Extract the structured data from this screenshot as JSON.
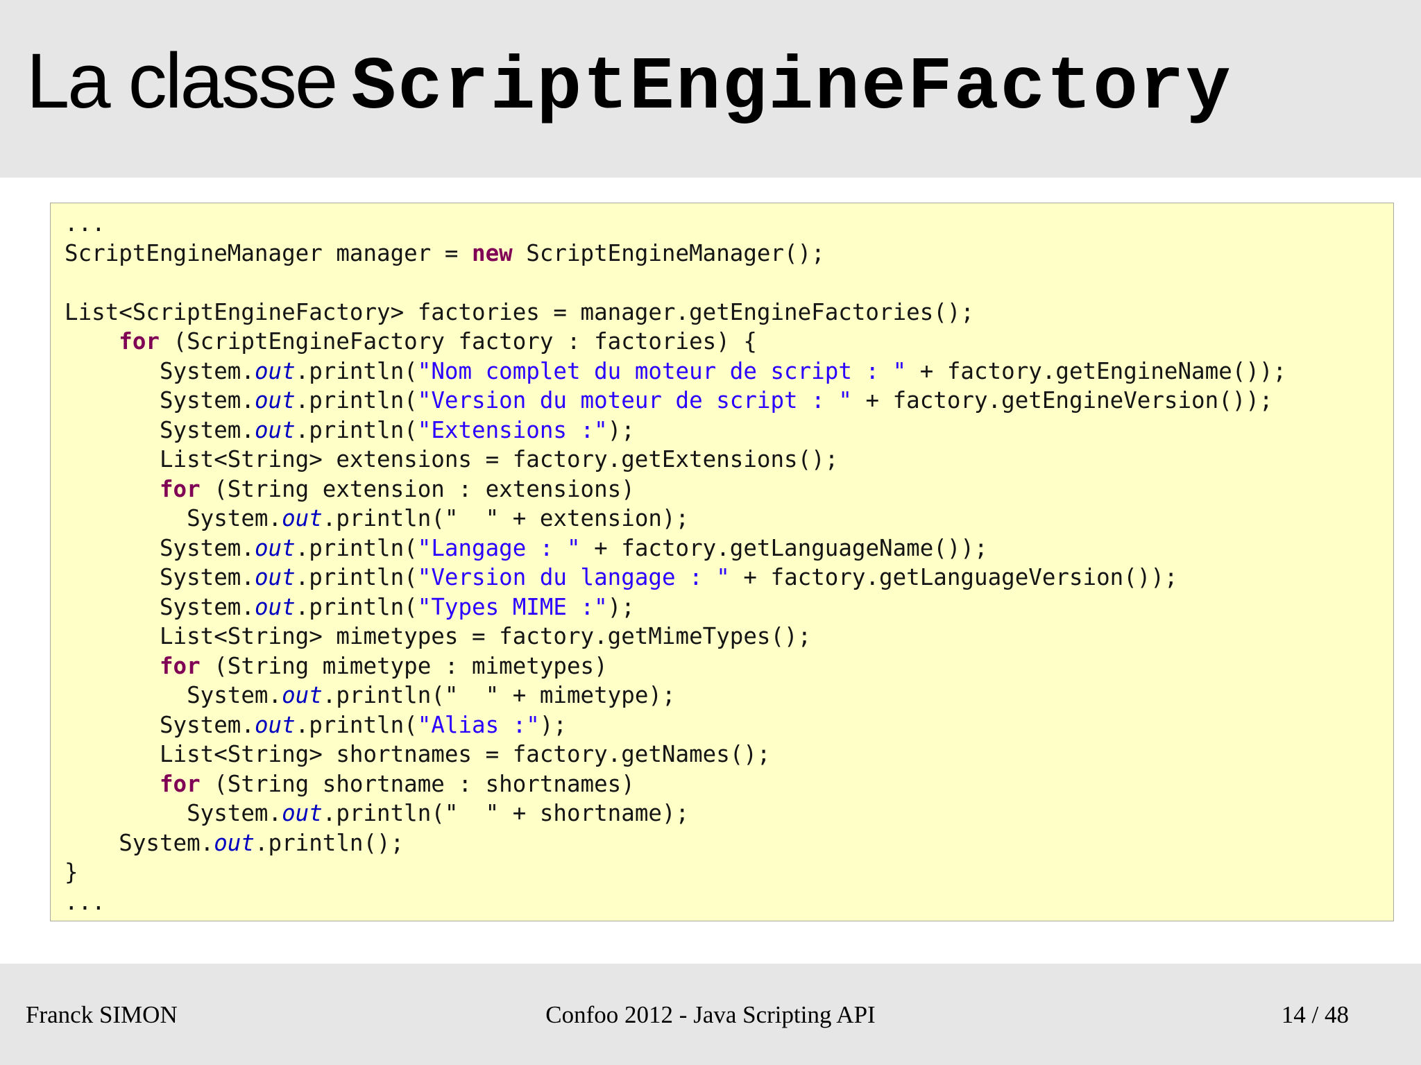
{
  "slide": {
    "title_text": "La classe",
    "title_code": "ScriptEngineFactory",
    "code_lines": [
      [
        {
          "t": "..."
        }
      ],
      [
        {
          "t": "ScriptEngineManager manager = "
        },
        {
          "t": "new",
          "c": "kw"
        },
        {
          "t": " ScriptEngineManager();"
        }
      ],
      [],
      [
        {
          "t": "List<ScriptEngineFactory> factories = manager.getEngineFactories();"
        }
      ],
      [
        {
          "t": "    "
        },
        {
          "t": "for",
          "c": "kw"
        },
        {
          "t": " (ScriptEngineFactory factory : factories) {"
        }
      ],
      [
        {
          "t": "       System."
        },
        {
          "t": "out",
          "c": "fld"
        },
        {
          "t": ".println("
        },
        {
          "t": "\"Nom complet du moteur de script : \"",
          "c": "str"
        },
        {
          "t": " + factory.getEngineName());"
        }
      ],
      [
        {
          "t": "       System."
        },
        {
          "t": "out",
          "c": "fld"
        },
        {
          "t": ".println("
        },
        {
          "t": "\"Version du moteur de script : \"",
          "c": "str"
        },
        {
          "t": " + factory.getEngineVersion());"
        }
      ],
      [
        {
          "t": "       System."
        },
        {
          "t": "out",
          "c": "fld"
        },
        {
          "t": ".println("
        },
        {
          "t": "\"Extensions :\"",
          "c": "str"
        },
        {
          "t": ");"
        }
      ],
      [
        {
          "t": "       List<String> extensions = factory.getExtensions();"
        }
      ],
      [
        {
          "t": "       "
        },
        {
          "t": "for",
          "c": "kw"
        },
        {
          "t": " (String extension : extensions)"
        }
      ],
      [
        {
          "t": "         System."
        },
        {
          "t": "out",
          "c": "fld"
        },
        {
          "t": ".println(\"  \" + extension);"
        }
      ],
      [
        {
          "t": "       System."
        },
        {
          "t": "out",
          "c": "fld"
        },
        {
          "t": ".println("
        },
        {
          "t": "\"Langage : \"",
          "c": "str"
        },
        {
          "t": " + factory.getLanguageName());"
        }
      ],
      [
        {
          "t": "       System."
        },
        {
          "t": "out",
          "c": "fld"
        },
        {
          "t": ".println("
        },
        {
          "t": "\"Version du langage : \"",
          "c": "str"
        },
        {
          "t": " + factory.getLanguageVersion());"
        }
      ],
      [
        {
          "t": "       System."
        },
        {
          "t": "out",
          "c": "fld"
        },
        {
          "t": ".println("
        },
        {
          "t": "\"Types MIME :\"",
          "c": "str"
        },
        {
          "t": ");"
        }
      ],
      [
        {
          "t": "       List<String> mimetypes = factory.getMimeTypes();"
        }
      ],
      [
        {
          "t": "       "
        },
        {
          "t": "for",
          "c": "kw"
        },
        {
          "t": " (String mimetype : mimetypes)"
        }
      ],
      [
        {
          "t": "         System."
        },
        {
          "t": "out",
          "c": "fld"
        },
        {
          "t": ".println(\"  \" + mimetype);"
        }
      ],
      [
        {
          "t": "       System."
        },
        {
          "t": "out",
          "c": "fld"
        },
        {
          "t": ".println("
        },
        {
          "t": "\"Alias :\"",
          "c": "str"
        },
        {
          "t": ");"
        }
      ],
      [
        {
          "t": "       List<String> shortnames = factory.getNames();"
        }
      ],
      [
        {
          "t": "       "
        },
        {
          "t": "for",
          "c": "kw"
        },
        {
          "t": " (String shortname : shortnames)"
        }
      ],
      [
        {
          "t": "         System."
        },
        {
          "t": "out",
          "c": "fld"
        },
        {
          "t": ".println(\"  \" + shortname);"
        }
      ],
      [
        {
          "t": "    System."
        },
        {
          "t": "out",
          "c": "fld"
        },
        {
          "t": ".println();"
        }
      ],
      [
        {
          "t": "}"
        }
      ],
      [
        {
          "t": "..."
        }
      ]
    ],
    "colors": {
      "keyword": "#7f0055",
      "field": "#0000c0",
      "string": "#2a00ff",
      "code_background": "#ffffc8",
      "band_background": "#e6e6e6"
    }
  },
  "footer": {
    "author": "Franck SIMON",
    "event": "Confoo 2012 - Java Scripting API",
    "page": "14 / 48"
  }
}
